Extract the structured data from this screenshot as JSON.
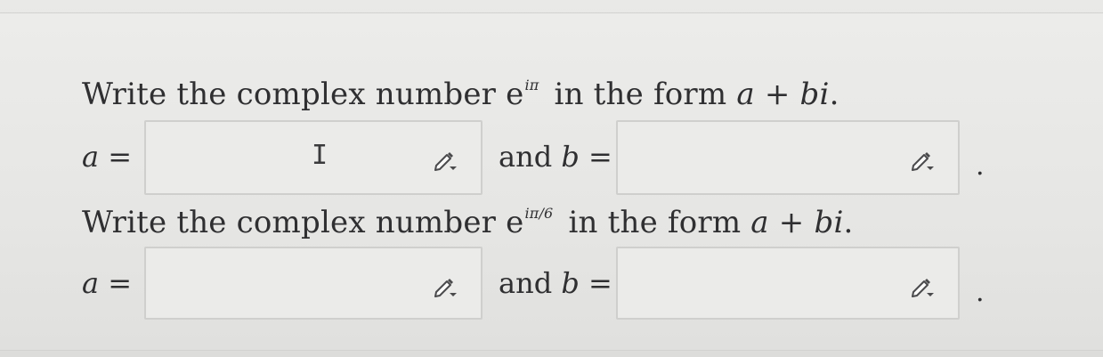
{
  "questions": [
    {
      "prefix": "Write the complex number ",
      "base": "e",
      "exponent": "iπ",
      "middle": " in the form ",
      "form_a": "a",
      "plus": " + ",
      "form_bi": "bi",
      "suffix": ".",
      "answer_a_label": "a =",
      "answer_a_value": "",
      "and_text": "and ",
      "answer_b_var": "b",
      "answer_b_eq": " =",
      "answer_b_value": "",
      "end_period": "."
    },
    {
      "prefix": "Write the complex number ",
      "base": "e",
      "exponent": "iπ/6",
      "middle": " in the form ",
      "form_a": "a",
      "plus": " + ",
      "form_bi": "bi",
      "suffix": ".",
      "answer_a_label": "a =",
      "answer_a_value": "",
      "and_text": "and ",
      "answer_b_var": "b",
      "answer_b_eq": " =",
      "answer_b_value": "",
      "end_period": "."
    }
  ],
  "cursor_glyph": "I",
  "icons": {
    "edit": "pencil-dropdown-icon"
  }
}
